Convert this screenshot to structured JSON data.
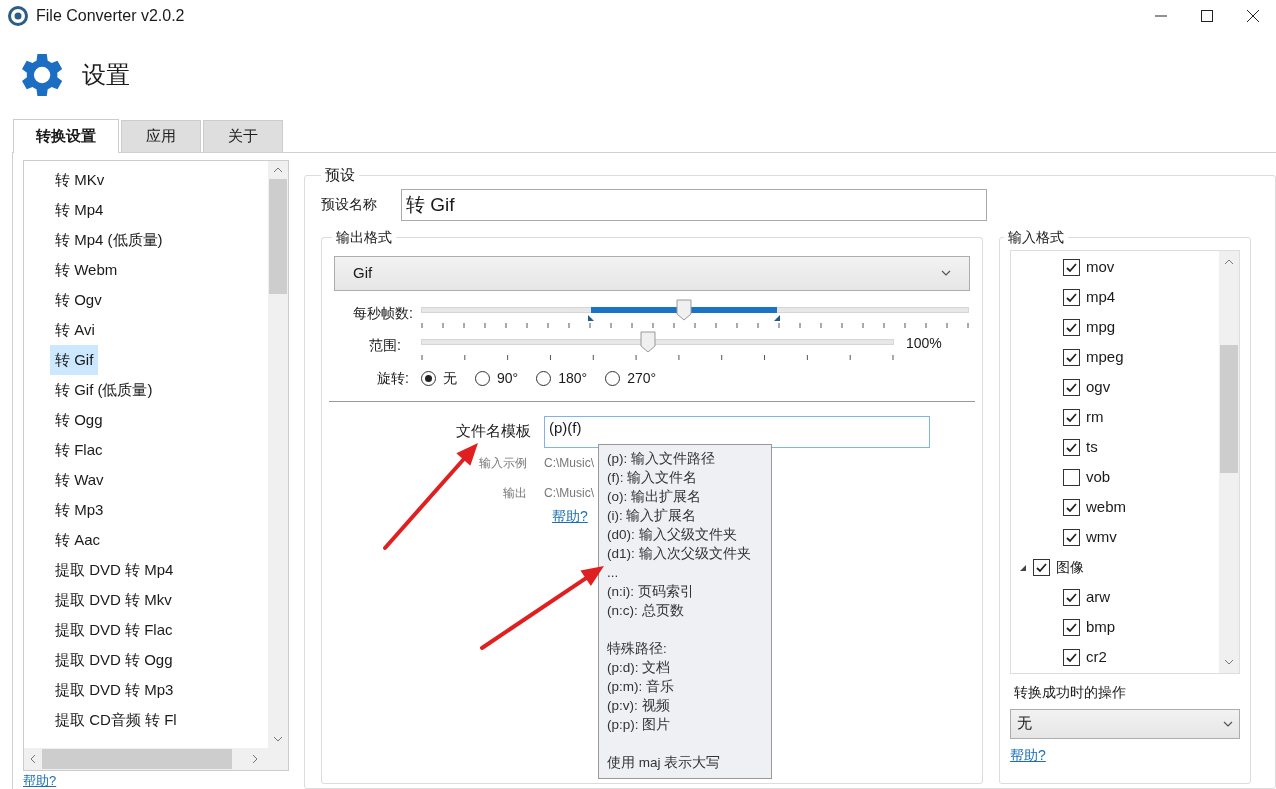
{
  "window": {
    "title": "File Converter v2.0.2"
  },
  "header": {
    "title": "设置"
  },
  "tabs": [
    {
      "label": "转换设置",
      "selected": true
    },
    {
      "label": "应用",
      "selected": false
    },
    {
      "label": "关于",
      "selected": false
    }
  ],
  "presets": {
    "items": [
      {
        "label": "转 MKv",
        "selected": false
      },
      {
        "label": "转 Mp4",
        "selected": false
      },
      {
        "label": "转 Mp4 (低质量)",
        "selected": false
      },
      {
        "label": "转 Webm",
        "selected": false
      },
      {
        "label": "转 Ogv",
        "selected": false
      },
      {
        "label": "转 Avi",
        "selected": false
      },
      {
        "label": "转 Gif",
        "selected": true
      },
      {
        "label": "转 Gif (低质量)",
        "selected": false
      },
      {
        "label": "转 Ogg",
        "selected": false
      },
      {
        "label": "转 Flac",
        "selected": false
      },
      {
        "label": "转 Wav",
        "selected": false
      },
      {
        "label": "转 Mp3",
        "selected": false
      },
      {
        "label": "转 Aac",
        "selected": false
      },
      {
        "label": "提取 DVD 转 Mp4",
        "selected": false
      },
      {
        "label": "提取 DVD 转 Mkv",
        "selected": false
      },
      {
        "label": "提取 DVD 转 Flac",
        "selected": false
      },
      {
        "label": "提取 DVD 转 Ogg",
        "selected": false
      },
      {
        "label": "提取 DVD 转 Mp3",
        "selected": false
      },
      {
        "label": "提取 CD音频 转 Fl",
        "selected": false
      }
    ],
    "help": "帮助?"
  },
  "preset": {
    "legend": "预设",
    "name_label": "预设名称",
    "name_value": "转 Gif",
    "output": {
      "legend": "输出格式",
      "format": "Gif",
      "fps": {
        "label": "每秒帧数:",
        "level": 0.48,
        "selection_start": {
          "level": 0.31
        },
        "selection_end": {
          "level": 0.65
        }
      },
      "range": {
        "label": "范围:",
        "level": 0.48,
        "reading": "100%"
      },
      "rotation": {
        "label": "旋转:",
        "options": [
          {
            "label": "无",
            "selected": true
          },
          {
            "label": "90°",
            "selected": false
          },
          {
            "label": "180°",
            "selected": false
          },
          {
            "label": "270°",
            "selected": false
          }
        ]
      },
      "template": {
        "label": "文件名模板",
        "value": "(p)(f)",
        "example_label": "输入示例",
        "example_value": "C:\\Music\\",
        "output_label": "输出",
        "output_value": "C:\\Music\\",
        "help": "帮助?"
      },
      "tooltip": {
        "sections": [
          {
            "lines": [
              "(p): 输入文件路径",
              "(f): 输入文件名",
              "(o): 输出扩展名",
              "(i): 输入扩展名",
              "(d0): 输入父级文件夹",
              "(d1): 输入次父级文件夹",
              "...",
              "(n:i): 页码索引",
              "(n:c): 总页数"
            ]
          },
          {
            "lines": [
              "特殊路径:",
              "(p:d): 文档",
              "(p:m): 音乐",
              "(p:v): 视频",
              "(p:p): 图片"
            ]
          },
          {
            "lines": [
              "使用 maj 表示大写"
            ]
          }
        ]
      }
    },
    "input": {
      "legend": "输入格式",
      "formats": [
        {
          "label": "mov",
          "checked": true
        },
        {
          "label": "mp4",
          "checked": true
        },
        {
          "label": "mpg",
          "checked": true
        },
        {
          "label": "mpeg",
          "checked": true
        },
        {
          "label": "ogv",
          "checked": true
        },
        {
          "label": "rm",
          "checked": true
        },
        {
          "label": "ts",
          "checked": true
        },
        {
          "label": "vob",
          "checked": false
        },
        {
          "label": "webm",
          "checked": true
        },
        {
          "label": "wmv",
          "checked": true
        },
        {
          "label": "图像",
          "checked": true,
          "expanded": true,
          "children": [
            {
              "label": "arw",
              "checked": true
            },
            {
              "label": "bmp",
              "checked": true
            },
            {
              "label": "cr2",
              "checked": true
            }
          ]
        }
      ],
      "success_label": "转换成功时的操作",
      "success_value": "无",
      "help": "帮助?"
    }
  }
}
